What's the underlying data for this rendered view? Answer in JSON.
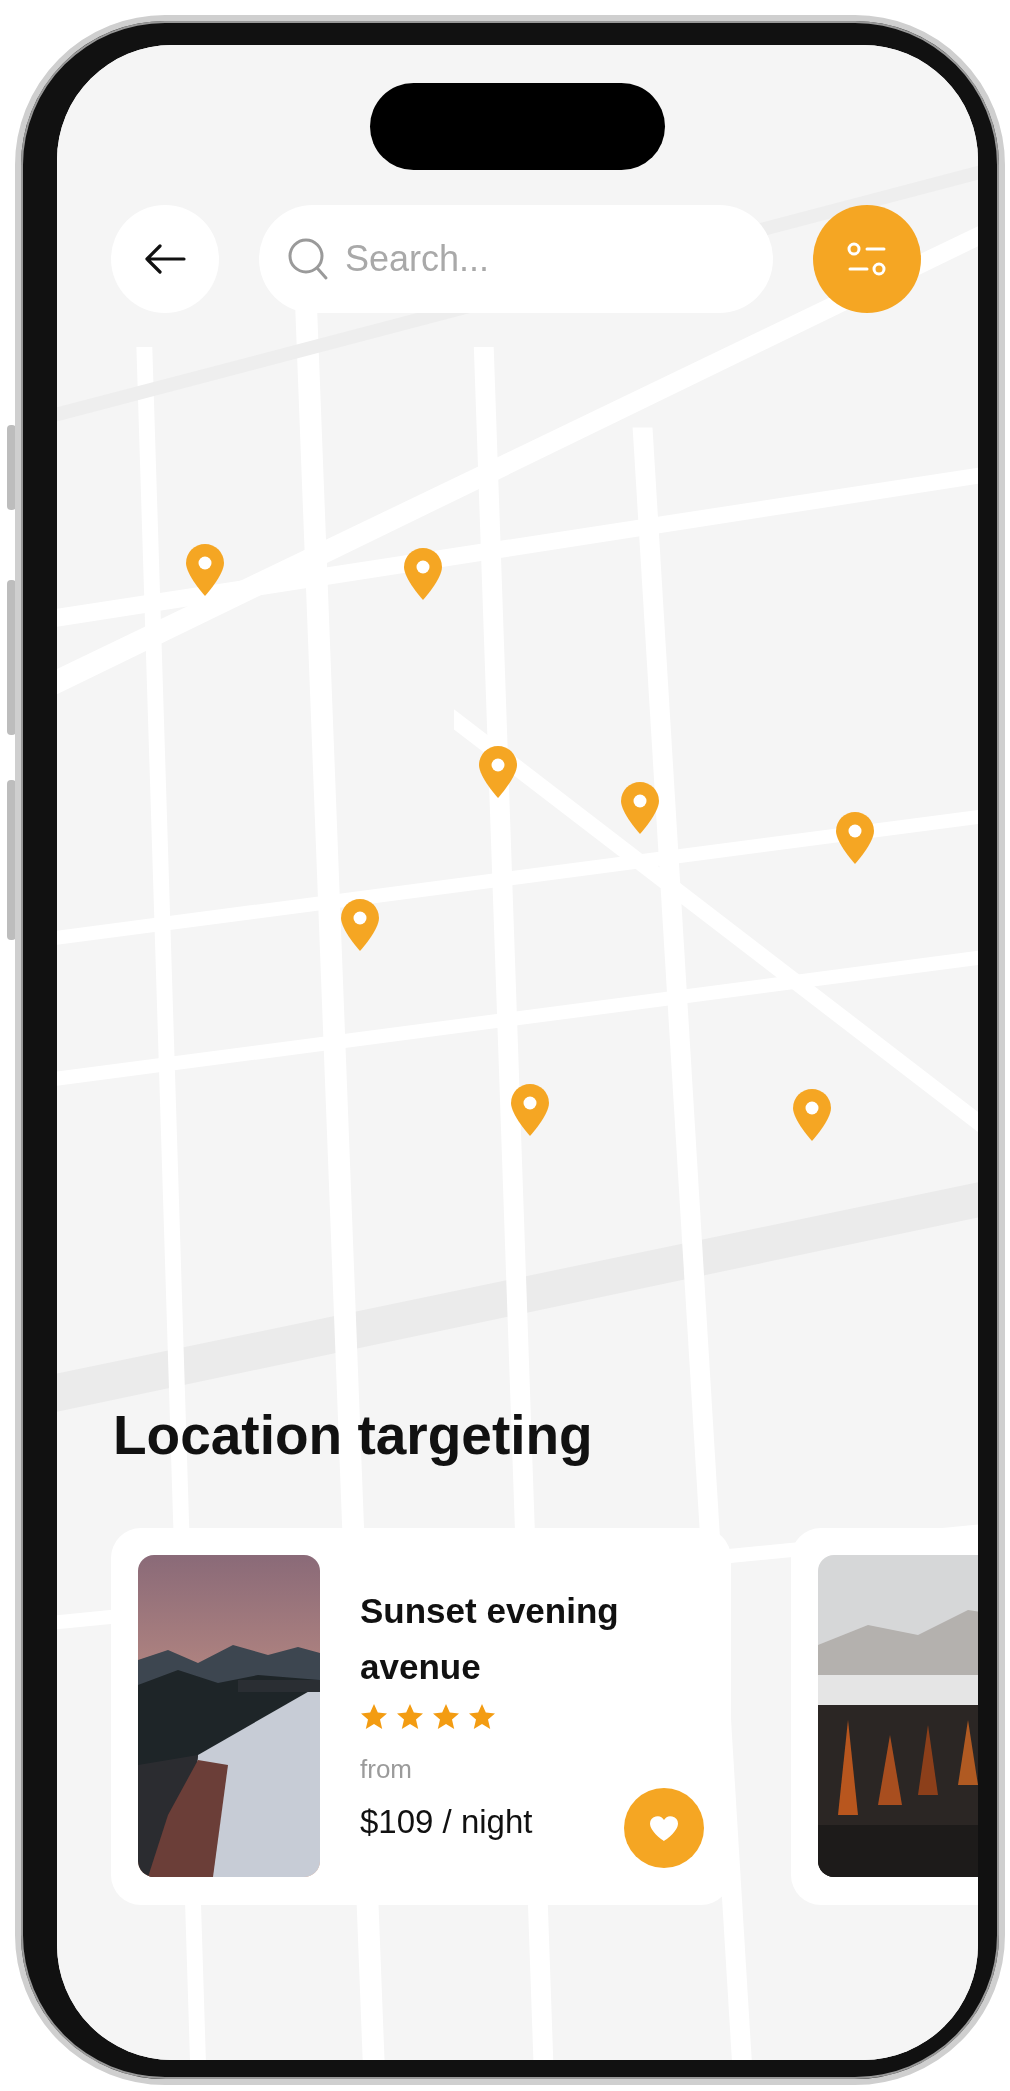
{
  "search": {
    "placeholder": "Search..."
  },
  "heading": "Location targeting",
  "listings": [
    {
      "kind": "listing",
      "title": "Sunset evening avenue",
      "stars": 4,
      "from_label": "from",
      "price": "$109 / night"
    },
    {
      "kind": "picture"
    }
  ]
}
